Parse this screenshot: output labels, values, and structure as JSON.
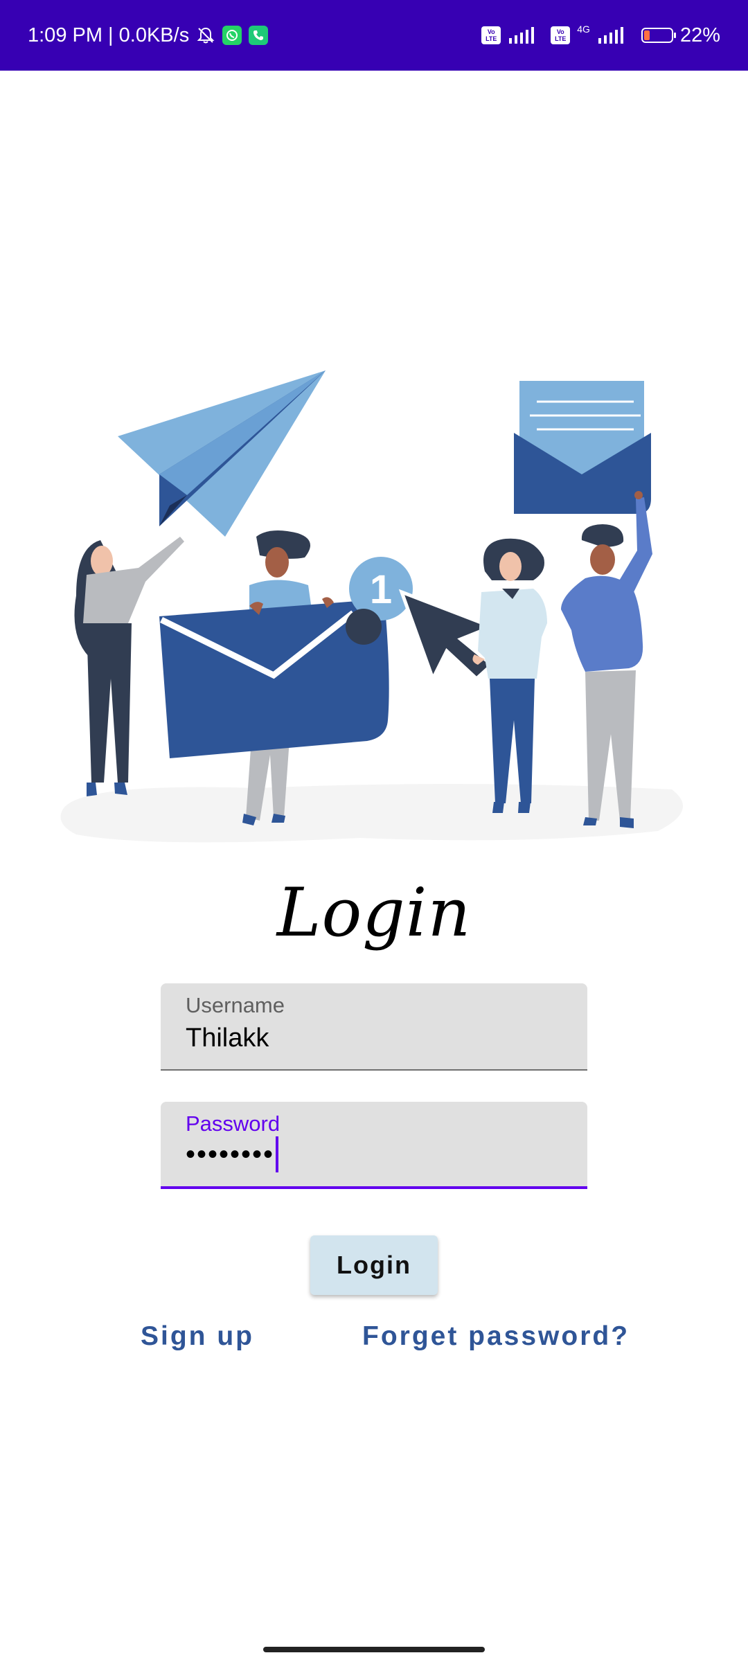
{
  "status_bar": {
    "time": "1:09 PM | 0.0KB/s",
    "network_label": "4G",
    "volte_label": "Vo LTE",
    "battery_percent": "22%",
    "battery_level": 0.22,
    "background_color": "#3700b3",
    "icons": [
      "mute-icon",
      "whatsapp-icon",
      "phone-icon",
      "signal-icon",
      "battery-icon"
    ]
  },
  "illustration": {
    "badge_count": "1"
  },
  "form": {
    "title": "Login",
    "username": {
      "label": "Username",
      "value": "Thilakk"
    },
    "password": {
      "label": "Password",
      "value": "••••••••"
    },
    "submit_label": "Login",
    "accent_color": "#6200ee"
  },
  "links": {
    "signup": "Sign up",
    "forget_password": "Forget password?"
  }
}
